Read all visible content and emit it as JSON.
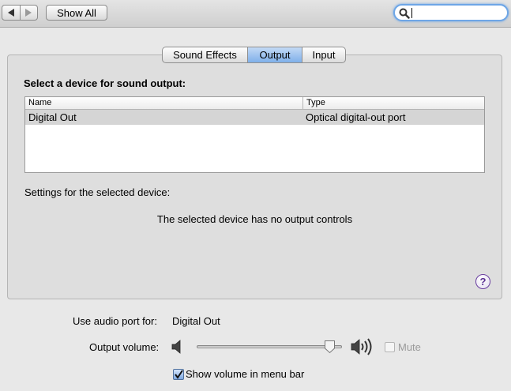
{
  "toolbar": {
    "back_icon": "back-arrow-icon",
    "forward_icon": "forward-arrow-icon",
    "show_all_label": "Show All",
    "search_value": "",
    "search_icon": "magnifier-icon"
  },
  "tabs": [
    {
      "label": "Sound Effects",
      "selected": false
    },
    {
      "label": "Output",
      "selected": true
    },
    {
      "label": "Input",
      "selected": false
    }
  ],
  "panel": {
    "title": "Select a device for sound output:",
    "table": {
      "columns": [
        "Name",
        "Type"
      ],
      "rows": [
        {
          "name": "Digital Out",
          "type": "Optical digital-out port",
          "selected": true
        }
      ]
    },
    "settings_label": "Settings for the selected device:",
    "no_controls_text": "The selected device has no output controls",
    "help_label": "?"
  },
  "bottom": {
    "audio_port_label": "Use audio port for:",
    "audio_port_value": "Digital Out",
    "output_volume_label": "Output volume:",
    "volume_level": 0.95,
    "mute_label": "Mute",
    "mute_checked": false,
    "mute_enabled": false,
    "show_volume_label": "Show volume in menu bar",
    "show_volume_checked": true
  },
  "colors": {
    "accent": "#7fb0ea",
    "selected_row": "#d5d5d5",
    "help_purple": "#5a2f92"
  }
}
